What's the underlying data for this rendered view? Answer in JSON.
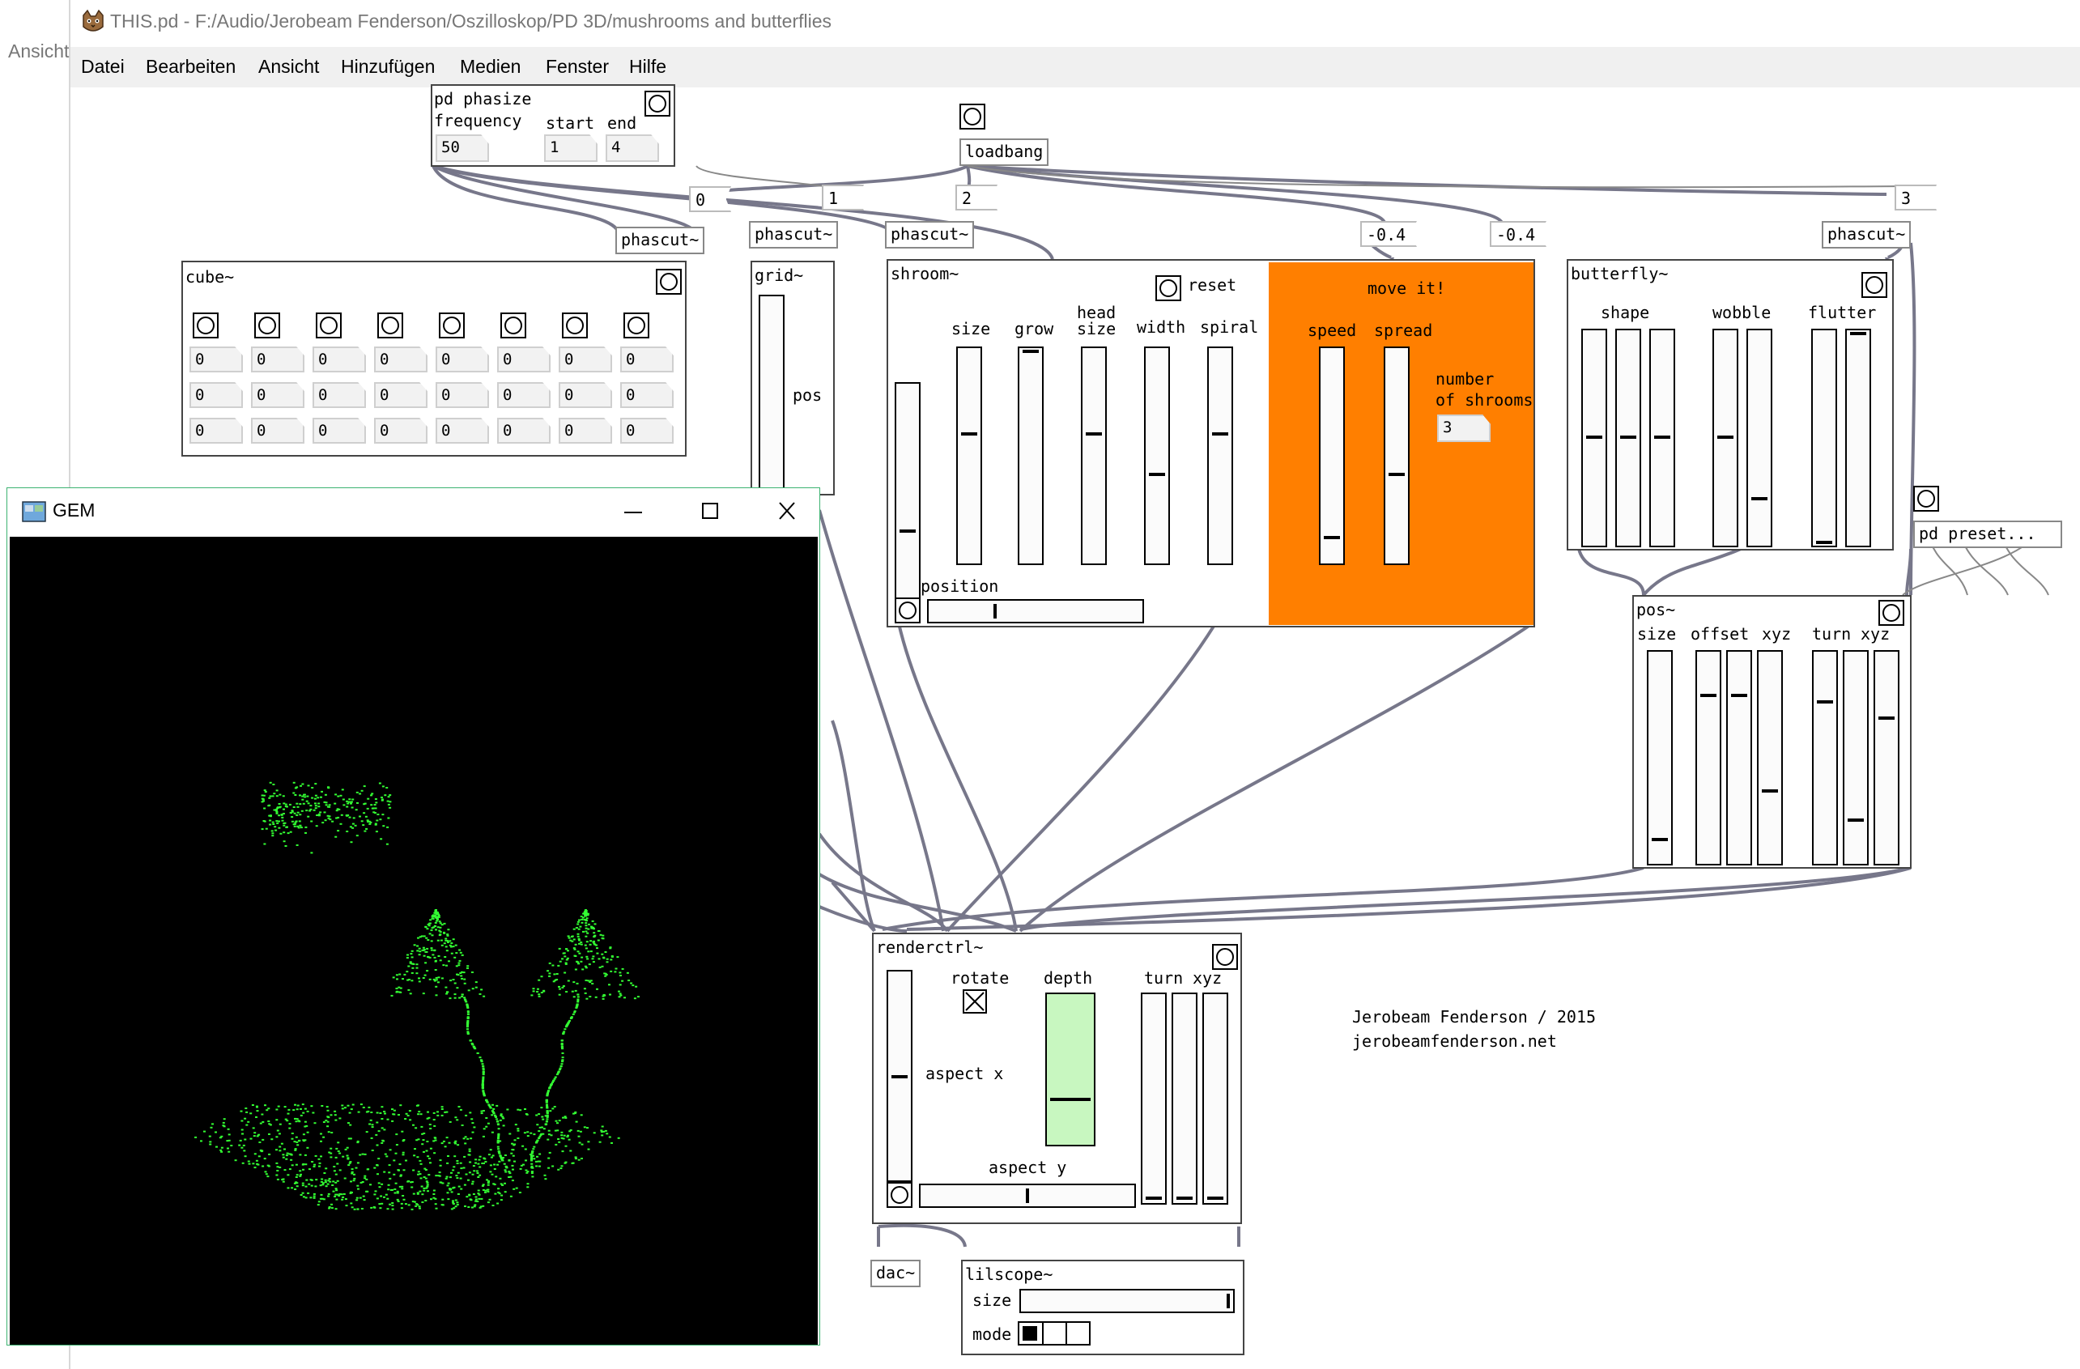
{
  "window": {
    "title": "THIS.pd",
    "path": " - F:/Audio/Jerobeam Fenderson/Oszilloskop/PD 3D/mushrooms and butterflies",
    "left_clip": "Ansicht"
  },
  "menu": [
    "Datei",
    "Bearbeiten",
    "Ansicht",
    "Hinzufügen",
    "Medien",
    "Fenster",
    "Hilfe"
  ],
  "phasize": {
    "title": "pd phasize",
    "frequency_label": "frequency",
    "start_label": "start",
    "end_label": "end",
    "frequency": "50",
    "start": "1",
    "end": "4"
  },
  "loadbang": "loadbang",
  "messages": {
    "m0": "0",
    "m1": "1",
    "m2": "2",
    "m3": "3",
    "mneg1": "-0.4",
    "mneg2": "-0.4"
  },
  "phascut": "phascut~",
  "cube": {
    "title": "cube~",
    "values": [
      "0",
      "0",
      "0",
      "0",
      "0",
      "0",
      "0",
      "0"
    ]
  },
  "grid": {
    "title": "grid~",
    "pos": "pos"
  },
  "shroom": {
    "title": "shroom~",
    "reset": "reset",
    "size": "size",
    "grow": "grow",
    "head": "head",
    "size2": "size",
    "width": "width",
    "spiral": "spiral",
    "position": "position",
    "move_it": "move it!",
    "speed": "speed",
    "spread": "spread",
    "number": "number",
    "of_shrooms": "of shrooms",
    "num_value": "3",
    "accent": "#ff7f00"
  },
  "butterfly": {
    "title": "butterfly~",
    "shape": "shape",
    "wobble": "wobble",
    "flutter": "flutter"
  },
  "preset": "pd preset...",
  "pos": {
    "title": "pos~",
    "size": "size",
    "offset": "offset",
    "xyz": "xyz",
    "turn": "turn",
    "xyz2": "xyz"
  },
  "renderctrl": {
    "title": "renderctrl~",
    "rotate": "rotate",
    "depth": "depth",
    "turn": "turn",
    "xyz": "xyz",
    "aspect_x": "aspect x",
    "aspect_y": "aspect y",
    "depth_color": "#c8f7c0"
  },
  "credits": {
    "line1": "Jerobeam Fenderson / 2015",
    "line2": "jerobeamfenderson.net"
  },
  "dac": "dac~",
  "lilscope": {
    "title": "lilscope~",
    "size": "size",
    "mode": "mode"
  },
  "gem": {
    "title": "GEM",
    "scope_color": "#33ff33"
  }
}
